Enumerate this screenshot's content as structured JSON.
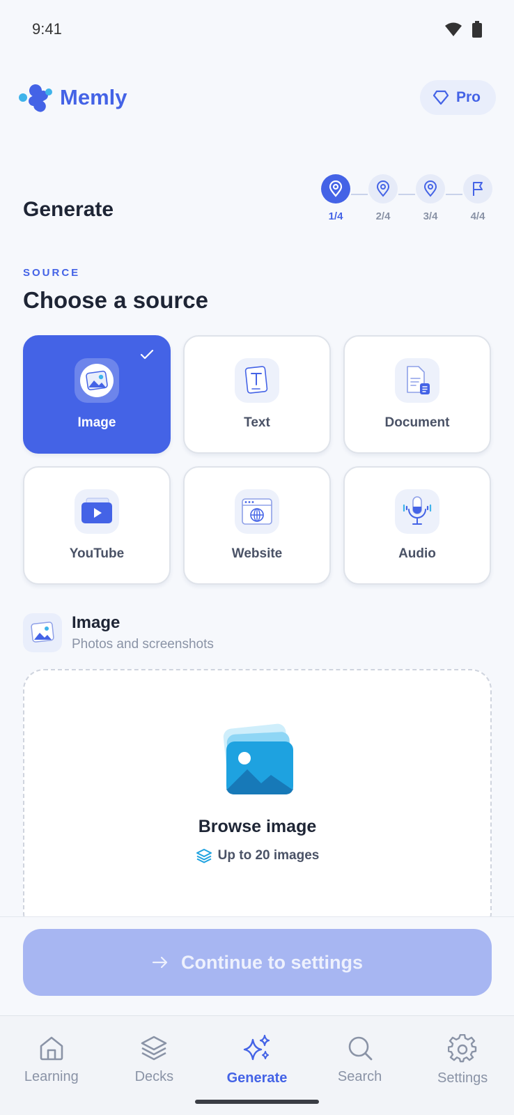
{
  "status": {
    "time": "9:41"
  },
  "app": {
    "name": "Memly",
    "pro_label": "Pro"
  },
  "page": {
    "title": "Generate"
  },
  "stepper": {
    "steps": [
      {
        "label": "1/4",
        "icon": "map-pin-icon",
        "active": true
      },
      {
        "label": "2/4",
        "icon": "map-pin-icon",
        "active": false
      },
      {
        "label": "3/4",
        "icon": "map-pin-icon",
        "active": false
      },
      {
        "label": "4/4",
        "icon": "flag-icon",
        "active": false
      }
    ]
  },
  "source": {
    "section_label": "SOURCE",
    "heading": "Choose a source",
    "options": [
      {
        "label": "Image",
        "icon": "image-icon",
        "selected": true
      },
      {
        "label": "Text",
        "icon": "text-icon",
        "selected": false
      },
      {
        "label": "Document",
        "icon": "document-icon",
        "selected": false
      },
      {
        "label": "YouTube",
        "icon": "youtube-icon",
        "selected": false
      },
      {
        "label": "Website",
        "icon": "website-icon",
        "selected": false
      },
      {
        "label": "Audio",
        "icon": "microphone-icon",
        "selected": false
      }
    ]
  },
  "selected_info": {
    "title": "Image",
    "subtitle": "Photos and screenshots"
  },
  "dropzone": {
    "title": "Browse image",
    "subtitle": "Up to 20 images"
  },
  "continue_label": "Continue to settings",
  "tabs": [
    {
      "label": "Learning",
      "icon": "home-icon",
      "active": false
    },
    {
      "label": "Decks",
      "icon": "layers-icon",
      "active": false
    },
    {
      "label": "Generate",
      "icon": "sparkles-icon",
      "active": true
    },
    {
      "label": "Search",
      "icon": "search-icon",
      "active": false
    },
    {
      "label": "Settings",
      "icon": "gear-icon",
      "active": false
    }
  ],
  "colors": {
    "accent": "#4463e6",
    "button_disabled": "#a7b6f2",
    "background": "#f6f8fc"
  }
}
